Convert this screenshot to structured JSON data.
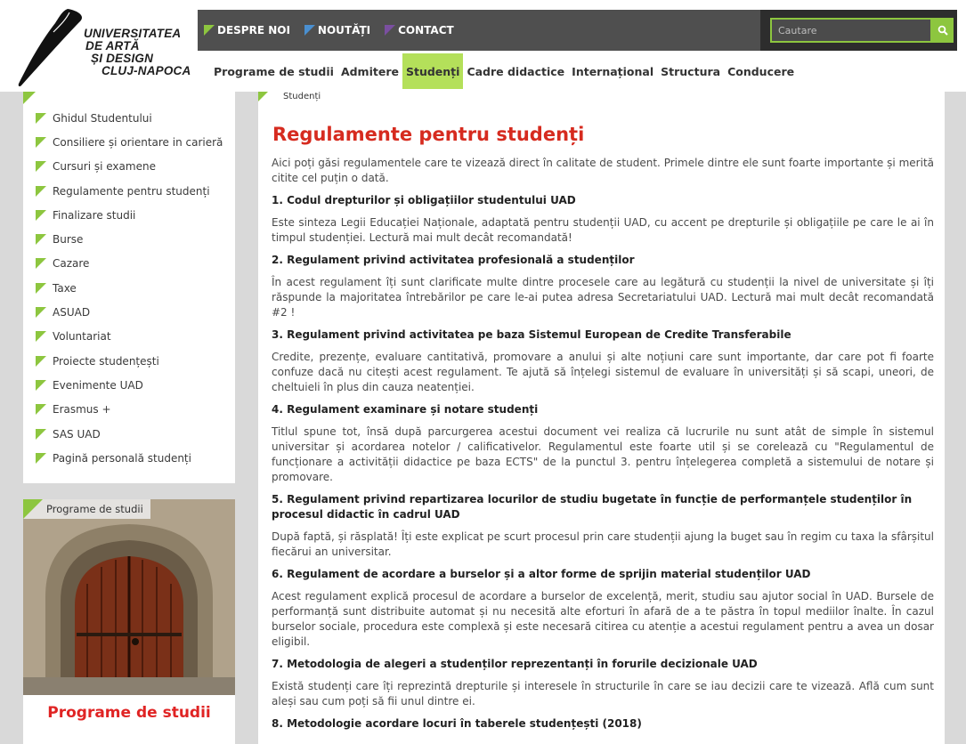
{
  "header": {
    "logo_lines": [
      "UNIVERSITATEA",
      "DE ARTĂ",
      "ȘI DESIGN",
      "CLUJ-NAPOCA"
    ],
    "top_links": [
      "DESPRE NOI",
      "NOUTĂȚI",
      "CONTACT"
    ],
    "search_placeholder": "Cautare",
    "main_nav": [
      "Programe de studii",
      "Admitere",
      "Studenți",
      "Cadre didactice",
      "Internațional",
      "Structura",
      "Conducere"
    ],
    "active_nav": "Studenți"
  },
  "colors": {
    "accent_green": "#8dc63f",
    "active_tab": "#b4e05a",
    "title_red": "#d62b1f",
    "topbar": "#4f4f4f"
  },
  "icons": {
    "search": "search-icon",
    "flag": "flag-icon"
  },
  "sidebar": {
    "items": [
      "Ghidul Studentului",
      "Consiliere și orientare in carieră",
      "Cursuri și examene",
      "Regulamente pentru studenți",
      "Finalizare studii",
      "Burse",
      "Cazare",
      "Taxe",
      "ASUAD",
      "Voluntariat",
      "Proiecte studențești",
      "Evenimente UAD",
      "Erasmus +",
      "SAS UAD",
      "Pagină personală studenți"
    ]
  },
  "promo": {
    "tag": "Programe de studii",
    "title": "Programe de studii"
  },
  "content": {
    "breadcrumb": "Studenți",
    "title": "Regulamente pentru studenți",
    "intro": "Aici poți găsi regulamentele care te vizează direct în calitate de student. Primele dintre ele sunt foarte importante și merită citite cel puțin o dată.",
    "sections": [
      {
        "heading": "1. Codul drepturilor și obligațiilor studentului UAD",
        "text": "Este sinteza Legii Educației Naționale, adaptată pentru studenții UAD, cu accent pe drepturile și obligațiile pe care le ai în timpul studenției. Lectură mai mult decât recomandată!"
      },
      {
        "heading": "2. Regulament privind activitatea profesională a studenților",
        "text": "În acest regulament îți sunt clarificate multe dintre procesele care au legătură cu studenții la nivel de universitate și îți răspunde la majoritatea întrebărilor pe care le-ai putea adresa Secretariatului UAD. Lectură mai mult decât recomandată #2 !"
      },
      {
        "heading": "3. Regulament privind activitatea pe baza Sistemul European de Credite Transferabile",
        "text": "Credite, prezențe, evaluare cantitativă, promovare a anului și alte noțiuni care sunt importante, dar care pot fi foarte confuze dacă nu citești acest regulament. Te ajută să înțelegi sistemul de evaluare în universități și să scapi, uneori, de cheltuieli în plus din cauza neatenției."
      },
      {
        "heading": "4. Regulament examinare și notare studenți",
        "text": "Titlul spune tot, însă după parcurgerea acestui document vei realiza că lucrurile nu sunt atât de simple în sistemul universitar și acordarea notelor / calificativelor. Regulamentul este foarte util și se corelează cu \"Regulamentul de funcționare a activității didactice pe baza ECTS\" de la punctul 3. pentru înțelegerea completă a sistemului de notare și promovare."
      },
      {
        "heading": "5. Regulament privind repartizarea locurilor de studiu bugetate în funcție de performanțele studenților în procesul didactic în cadrul UAD",
        "text": "După faptă, și răsplată! Îți este explicat pe scurt procesul prin care studenții ajung la buget sau în regim cu taxa la sfârșitul fiecărui an universitar."
      },
      {
        "heading": "6. Regulament de acordare a burselor și a altor forme de sprijin material studenților UAD",
        "text": "Acest regulament explică procesul de acordare a burselor de excelență, merit, studiu sau ajutor social în UAD. Bursele de performanță sunt distribuite automat și nu necesită alte eforturi în afară de a te păstra în topul mediilor înalte. În cazul burselor sociale, procedura este complexă și este necesară citirea cu atenție a acestui regulament pentru a avea un dosar eligibil."
      },
      {
        "heading": "7. Metodologia de alegeri a studenților reprezentanți în forurile decizionale UAD",
        "text": "Există studenți care îți reprezintă drepturile și interesele în structurile în care se iau decizii care te vizează. Află cum sunt aleși sau cum poți să fii unul dintre ei."
      },
      {
        "heading": "8. Metodologie acordare locuri în taberele studențești (2018)",
        "text": ""
      }
    ]
  }
}
